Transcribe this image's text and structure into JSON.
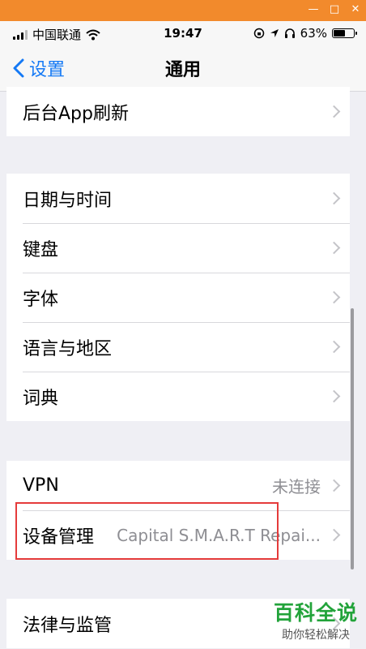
{
  "window": {
    "minimize": "—",
    "maximize": "□",
    "close": "✕"
  },
  "status_bar": {
    "carrier": "中国联通",
    "time": "19:47",
    "battery": "63%",
    "battery_level": 0.63,
    "icons": [
      "signal-icon",
      "wifi-icon",
      "rotation-lock-icon",
      "location-icon",
      "headphones-icon",
      "battery-icon"
    ]
  },
  "nav": {
    "back_label": "设置",
    "title": "通用"
  },
  "groups": [
    {
      "rows": [
        {
          "label": "后台App刷新",
          "value": ""
        }
      ]
    },
    {
      "rows": [
        {
          "label": "日期与时间",
          "value": ""
        },
        {
          "label": "键盘",
          "value": ""
        },
        {
          "label": "字体",
          "value": ""
        },
        {
          "label": "语言与地区",
          "value": ""
        },
        {
          "label": "词典",
          "value": ""
        }
      ]
    },
    {
      "rows": [
        {
          "label": "VPN",
          "value": "未连接"
        },
        {
          "label": "设备管理",
          "value": "Capital S.M.A.R.T Repai..."
        }
      ]
    },
    {
      "rows": [
        {
          "label": "法律与监管",
          "value": ""
        }
      ]
    }
  ],
  "watermark": {
    "title": "百科全说",
    "subtitle": "助你轻松解决"
  },
  "colors": {
    "accent": "#1479f5",
    "highlight": "#e53b3b",
    "watermark": "#22a33a",
    "window_bar": "#f28a2c"
  }
}
